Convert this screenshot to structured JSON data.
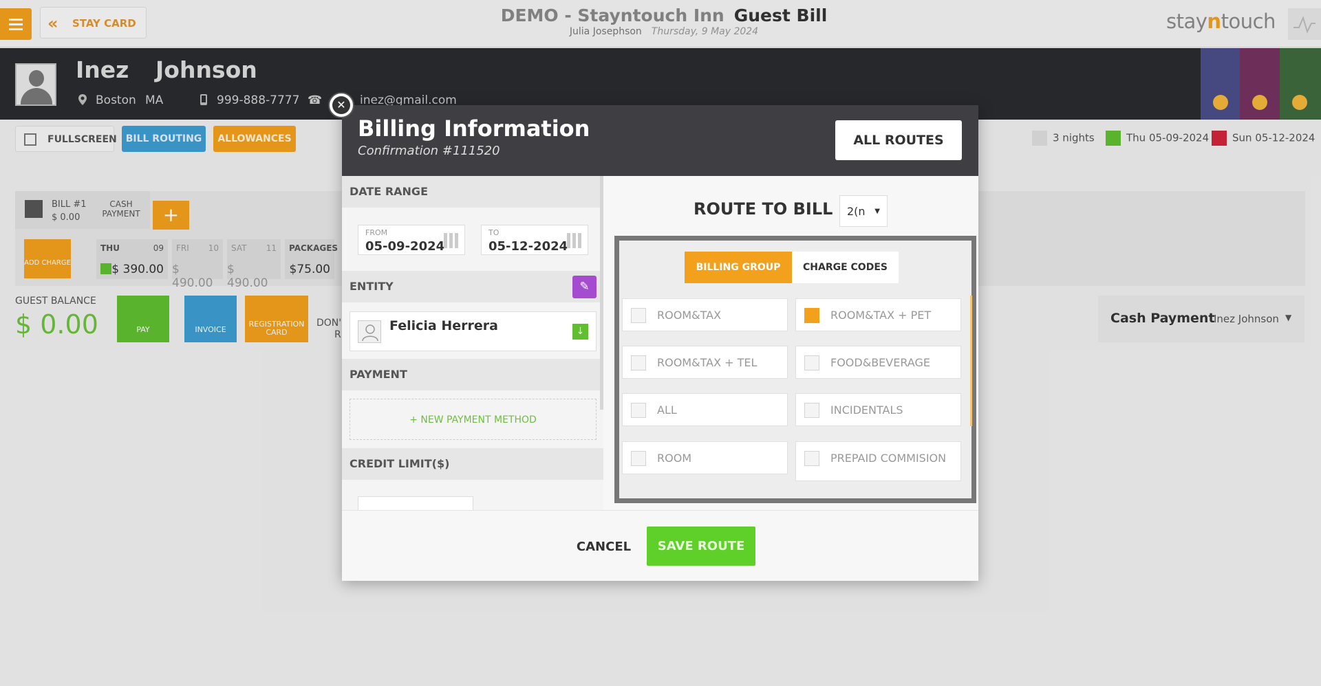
{
  "topbar": {
    "back_label": "STAY CARD",
    "hotel": "DEMO - Stayntouch Inn",
    "page": "Guest Bill",
    "user": "Julia Josephson",
    "date": "Thursday, 9 May 2024",
    "logo_pre": "stay",
    "logo_mid": "n",
    "logo_post": "touch"
  },
  "guest": {
    "first_name": "Inez",
    "last_name": "Johnson",
    "city": "Boston",
    "state": "MA",
    "mobile": "999-888-7777",
    "email": "inez@gmail.com"
  },
  "actions": {
    "fullscreen": "FULLSCREEN",
    "bill_routing": "BILL ROUTING",
    "allowances": "ALLOWANCES"
  },
  "stay": {
    "nights": "3 nights",
    "arrival": "Thu 05-09-2024",
    "departure": "Sun 05-12-2024"
  },
  "bill": {
    "title": "BILL #1",
    "amount": "$ 0.00",
    "cash_payment_tab": "CASH PAYMENT",
    "add_charge": "ADD CHARGE",
    "days": [
      {
        "name": "THU",
        "day": "09",
        "value": "$ 390.00"
      },
      {
        "name": "FRI",
        "day": "10",
        "value": "$ 490.00"
      },
      {
        "name": "SAT",
        "day": "11",
        "value": "$ 490.00"
      },
      {
        "name": "PACKAGES",
        "day": "",
        "value": "$75.00"
      }
    ],
    "balance_label": "GUEST BALANCE",
    "balance_value": "$ 0.00",
    "pay": "PAY",
    "invoice": "INVOICE",
    "registration": "REGISTRATION CARD",
    "dont_1": "DON'",
    "dont_2": "R",
    "payment_type": "Cash Payment",
    "payment_name": "Inez Johnson"
  },
  "modal": {
    "title": "Billing Information",
    "confirmation": "Confirmation #111520",
    "all_routes": "ALL ROUTES",
    "date_range_label": "DATE RANGE",
    "from_label": "FROM",
    "from_value": "05-09-2024",
    "to_label": "TO",
    "to_value": "05-12-2024",
    "entity_label": "ENTITY",
    "entity_name": "Felicia Herrera",
    "payment_label": "PAYMENT",
    "new_payment": "+ NEW PAYMENT METHOD",
    "credit_limit_label": "CREDIT LIMIT($)",
    "route_to_bill_label": "ROUTE TO BILL #",
    "route_to_bill_value": "2(n",
    "tab_billing_group": "BILLING GROUP",
    "tab_charge_codes": "CHARGE CODES",
    "groups": [
      {
        "label": "ROOM&TAX",
        "checked": false
      },
      {
        "label": "ROOM&TAX + PET",
        "checked": true
      },
      {
        "label": "ROOM&TAX + TEL",
        "checked": false
      },
      {
        "label": "FOOD&BEVERAGE",
        "checked": false
      },
      {
        "label": "ALL",
        "checked": false
      },
      {
        "label": "INCIDENTALS",
        "checked": false
      },
      {
        "label": "ROOM",
        "checked": false
      },
      {
        "label": "PREPAID COMMISION",
        "checked": false
      }
    ],
    "cancel": "CANCEL",
    "save_route": "SAVE ROUTE"
  },
  "colors": {
    "accent": "#f3a01c",
    "green": "#5fbf30",
    "blue": "#3d9dd2",
    "header_dark": "#2a2b2f",
    "purple": "#a54bd0"
  },
  "icons": [
    "menu-icon",
    "chevrons-left-icon",
    "activity-icon",
    "avatar-icon",
    "location-icon",
    "mobile-icon",
    "phone-icon",
    "close-icon",
    "expand-icon",
    "calendar-icon",
    "pencil-icon",
    "download-icon",
    "plus-icon",
    "moon-icon",
    "arrival-icon",
    "departure-icon"
  ]
}
